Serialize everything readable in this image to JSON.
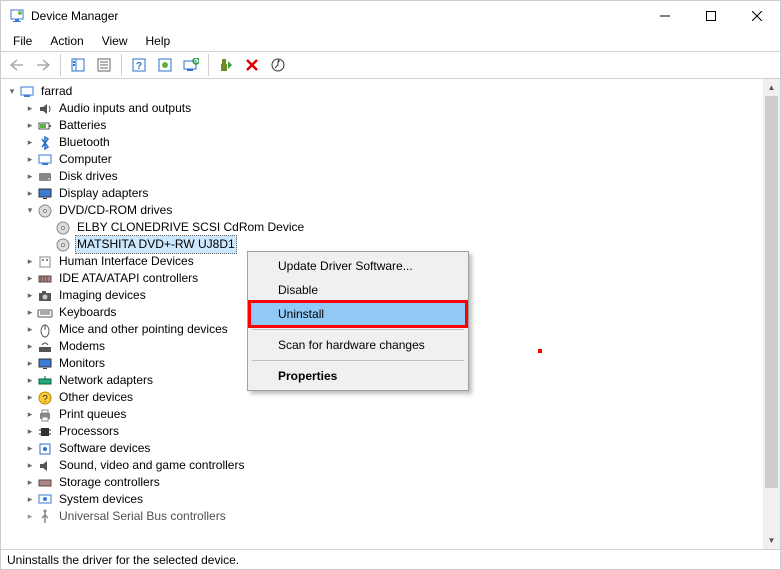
{
  "window": {
    "title": "Device Manager"
  },
  "menu": {
    "file": "File",
    "action": "Action",
    "view": "View",
    "help": "Help"
  },
  "tree": {
    "root": "farrad",
    "items": [
      "Audio inputs and outputs",
      "Batteries",
      "Bluetooth",
      "Computer",
      "Disk drives",
      "Display adapters"
    ],
    "dvd": {
      "label": "DVD/CD-ROM drives",
      "children": [
        "ELBY CLONEDRIVE SCSI CdRom Device",
        "MATSHITA DVD+-RW UJ8D1"
      ]
    },
    "items2": [
      "Human Interface Devices",
      "IDE ATA/ATAPI controllers",
      "Imaging devices",
      "Keyboards",
      "Mice and other pointing devices",
      "Modems",
      "Monitors",
      "Network adapters",
      "Other devices",
      "Print queues",
      "Processors",
      "Software devices",
      "Sound, video and game controllers",
      "Storage controllers",
      "System devices",
      "Universal Serial Bus controllers"
    ]
  },
  "context_menu": {
    "update": "Update Driver Software...",
    "disable": "Disable",
    "uninstall": "Uninstall",
    "scan": "Scan for hardware changes",
    "properties": "Properties"
  },
  "statusbar": {
    "text": "Uninstalls the driver for the selected device."
  }
}
